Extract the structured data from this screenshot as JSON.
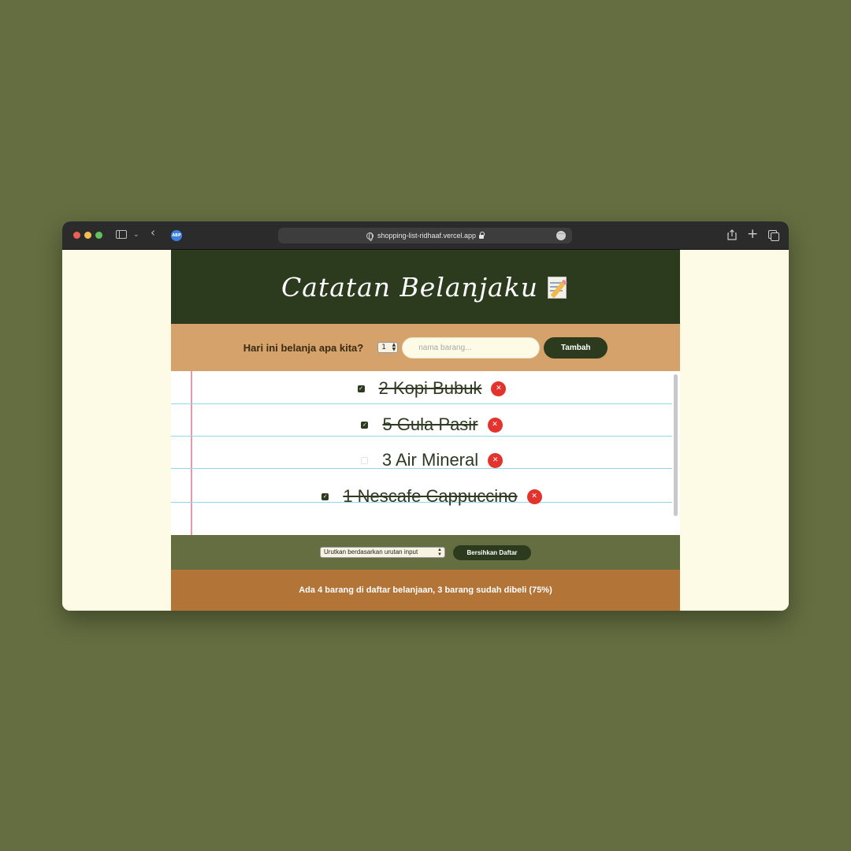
{
  "browser": {
    "url": "shopping-list-ridhaaf.vercel.app",
    "extension_badge": "ABP"
  },
  "app": {
    "title": "Catatan Belanjaku",
    "title_icon": "memo-icon"
  },
  "form": {
    "question": "Hari ini belanja apa kita?",
    "quantity": "1",
    "input_placeholder": "nama barang...",
    "input_value": "",
    "add_label": "Tambah"
  },
  "items": [
    {
      "text": "2 Kopi Bubuk",
      "checked": true
    },
    {
      "text": "5 Gula Pasir",
      "checked": true
    },
    {
      "text": "3 Air Mineral",
      "checked": false
    },
    {
      "text": "1 Nescafe Cappuccino",
      "checked": true
    }
  ],
  "actions": {
    "sort_selected": "Urutkan berdasarkan urutan input",
    "clear_label": "Bersihkan Daftar"
  },
  "stats": {
    "text": "Ada 4 barang di daftar belanjaan, 3 barang sudah dibeli (75%)"
  },
  "colors": {
    "background": "#646e40",
    "header": "#2c3a1d",
    "form": "#d4a26a",
    "actions": "#646e40",
    "stats": "#b27437",
    "delete": "#e2332c"
  }
}
